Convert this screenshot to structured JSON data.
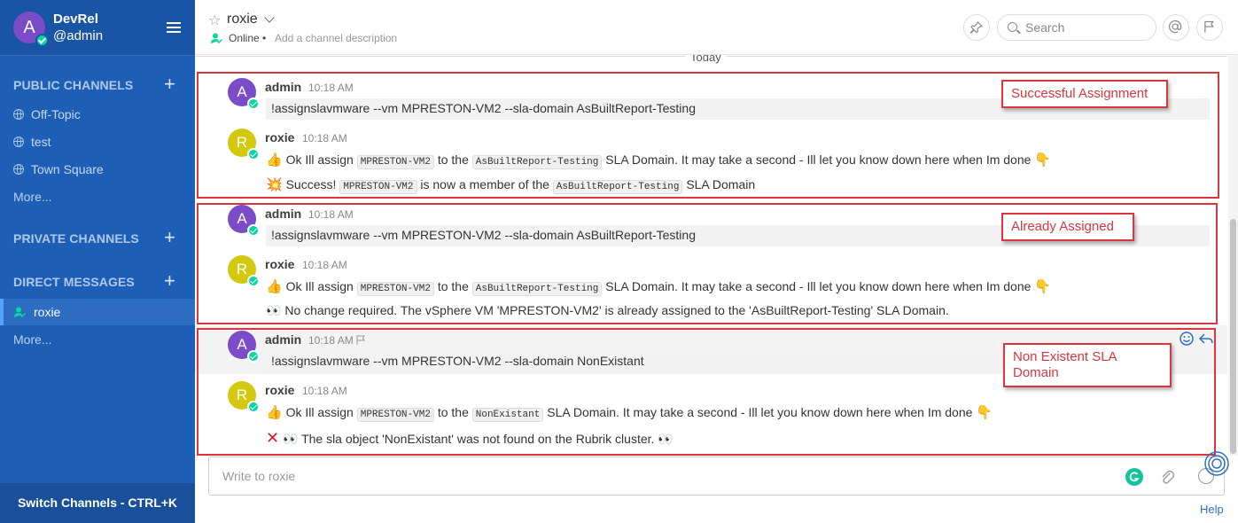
{
  "colors": {
    "sidebar": "#1d5fb7",
    "accent": "#2f6fc4",
    "annotation": "#d9363e",
    "online": "#06d6a0",
    "admin_avatar": "#7b4cc7",
    "roxie_avatar": "#d3c80e"
  },
  "sidebar": {
    "team_initial": "A",
    "team_name": "DevRel",
    "username": "@admin",
    "public_title": "PUBLIC CHANNELS",
    "public_channels": [
      "Off-Topic",
      "test",
      "Town Square"
    ],
    "more_public": "More...",
    "private_title": "PRIVATE CHANNELS",
    "dm_title": "DIRECT MESSAGES",
    "dm_active": "roxie",
    "more_dm": "More...",
    "switch_channels": "Switch Channels - CTRL+K"
  },
  "header": {
    "channel_name": "roxie",
    "status": "Online",
    "separator": "•",
    "description_placeholder": "Add a channel description",
    "search_placeholder": "Search"
  },
  "divider": "Today",
  "posts": [
    {
      "author": "admin",
      "initial": "A",
      "time": "10:18 AM",
      "text": "!assignslavmware --vm MPRESTON-VM2 --sla-domain AsBuiltReport-Testing"
    },
    {
      "author": "roxie",
      "initial": "R",
      "time": "10:18 AM",
      "l1a": "Ok Ill assign",
      "l1_code1": "MPRESTON-VM2",
      "l1b": "to the",
      "l1_code2": "AsBuiltReport-Testing",
      "l1c": "SLA Domain. It may take a second - Ill let you know down here when Im done",
      "l2a": "Success!",
      "l2_code1": "MPRESTON-VM2",
      "l2b": "is now a member of the",
      "l2_code2": "AsBuiltReport-Testing",
      "l2c": "SLA Domain"
    },
    {
      "author": "admin",
      "initial": "A",
      "time": "10:18 AM",
      "text": "!assignslavmware --vm MPRESTON-VM2 --sla-domain AsBuiltReport-Testing"
    },
    {
      "author": "roxie",
      "initial": "R",
      "time": "10:18 AM",
      "l1a": "Ok Ill assign",
      "l1_code1": "MPRESTON-VM2",
      "l1b": "to the",
      "l1_code2": "AsBuiltReport-Testing",
      "l1c": "SLA Domain. It may take a second - Ill let you know down here when Im done",
      "l2": "No change required. The vSphere VM 'MPRESTON-VM2' is already assigned to the 'AsBuiltReport-Testing' SLA Domain."
    },
    {
      "author": "admin",
      "initial": "A",
      "time": "10:18 AM",
      "text": "!assignslavmware --vm MPRESTON-VM2 --sla-domain NonExistant"
    },
    {
      "author": "roxie",
      "initial": "R",
      "time": "10:18 AM",
      "l1a": "Ok Ill assign",
      "l1_code1": "MPRESTON-VM2",
      "l1b": "to the",
      "l1_code2": "NonExistant",
      "l1c": "SLA Domain. It may take a second - Ill let you know down here when Im done",
      "l2": "The sla object 'NonExistant' was not found on the Rubrik cluster."
    }
  ],
  "annotations": [
    "Successful Assignment",
    "Already Assigned",
    "Non Existent SLA\nDomain"
  ],
  "input_placeholder": "Write to roxie",
  "help": "Help",
  "icons": [
    "hamburger-icon",
    "plus-icon",
    "globe-icon",
    "dm-icon",
    "star-icon",
    "chevron-down-icon",
    "pin-icon",
    "search-icon",
    "at-icon",
    "flag-icon",
    "thumbs-up-icon",
    "point-down-icon",
    "boom-icon",
    "eyes-icon",
    "cross-icon",
    "smiley-icon",
    "reply-icon",
    "grammarly-icon",
    "attach-icon",
    "emoji-icon"
  ]
}
